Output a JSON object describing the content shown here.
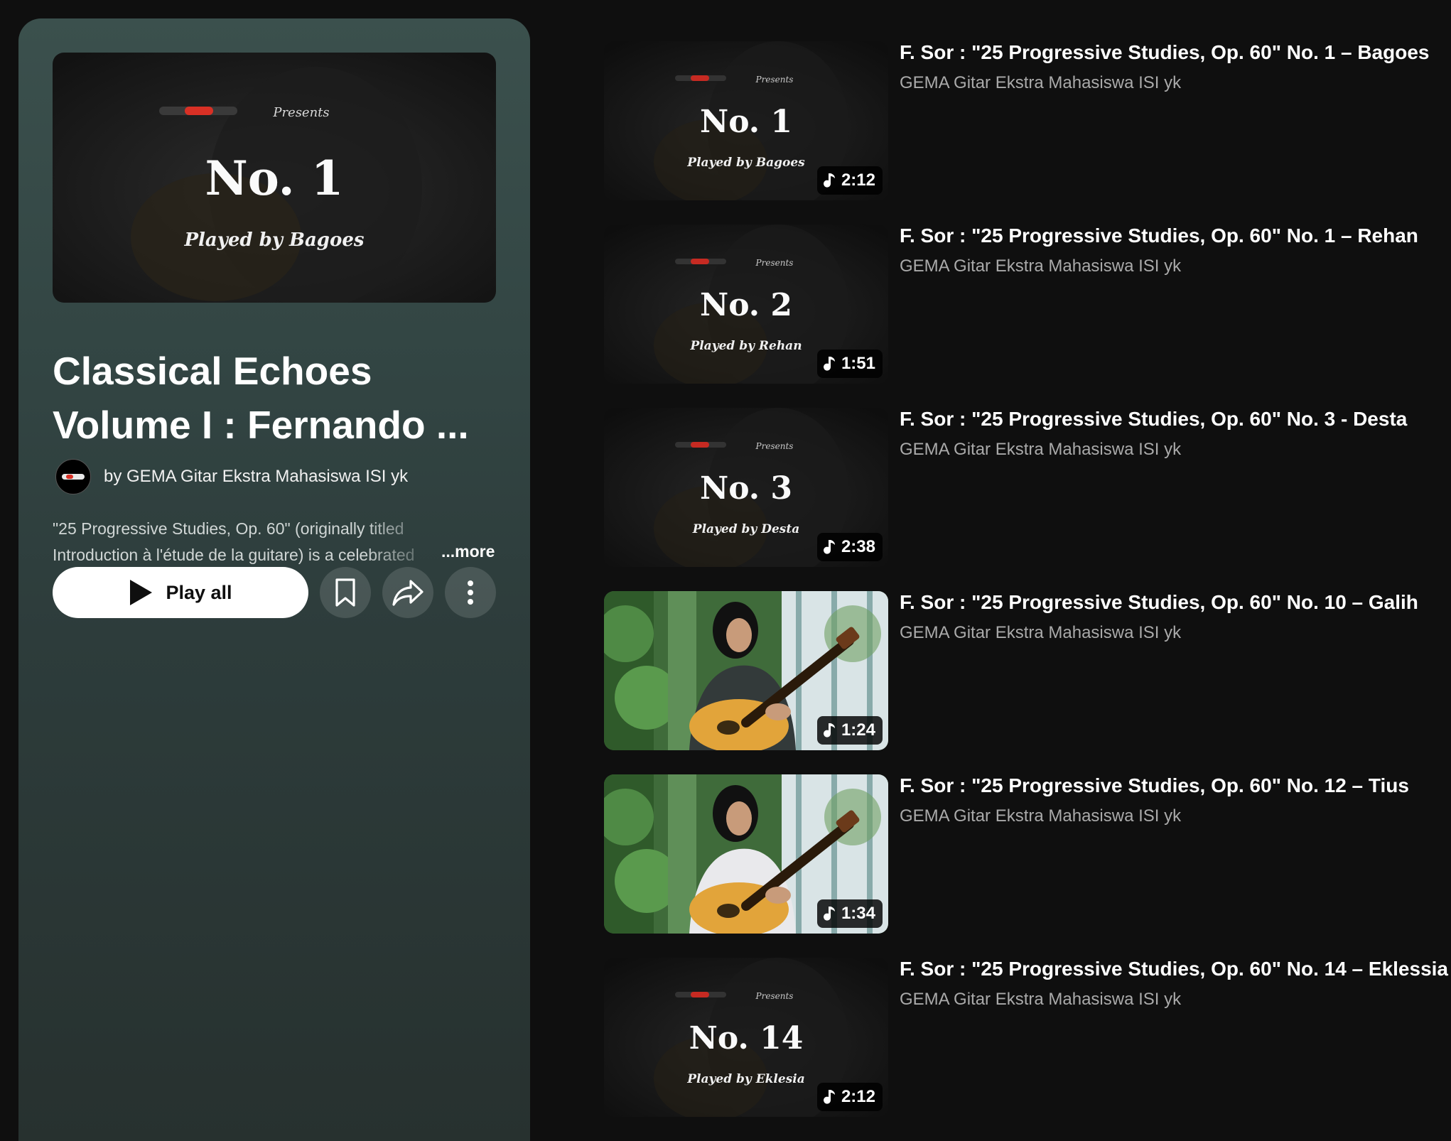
{
  "playlist": {
    "title_line1": "Classical Echoes",
    "title_line2": "Volume I : Fernando ...",
    "owner": "by GEMA Gitar Ekstra Mahasiswa ISI yk",
    "description_line1": "\"25 Progressive Studies, Op. 60\" (originally titled",
    "description_line2": "Introduction à l'étude de la guitare) is a celebrated",
    "more_label": "...more",
    "play_all_label": "Play all",
    "hero": {
      "presents": "Presents",
      "number": "No. 1",
      "played_by": "Played by Bagoes"
    }
  },
  "icons": {
    "play": "play-icon",
    "save": "bookmark-icon",
    "share": "share-icon",
    "menu": "more-vertical-icon",
    "music": "music-note-icon"
  },
  "videos": [
    {
      "title": "F. Sor : \"25 Progressive Studies, Op. 60\" No. 1 – Bagoes",
      "channel": "GEMA Gitar Ekstra Mahasiswa ISI yk",
      "duration": "2:12",
      "thumb": {
        "style": "card",
        "presents": "Presents",
        "number": "No. 1",
        "played_by": "Played by Bagoes"
      }
    },
    {
      "title": "F. Sor : \"25 Progressive Studies, Op. 60\" No. 1 – Rehan",
      "channel": "GEMA Gitar Ekstra Mahasiswa ISI yk",
      "duration": "1:51",
      "thumb": {
        "style": "card",
        "presents": "Presents",
        "number": "No. 2",
        "played_by": "Played by Rehan"
      }
    },
    {
      "title": "F. Sor : \"25 Progressive Studies, Op. 60\" No. 3 - Desta",
      "channel": "GEMA Gitar Ekstra Mahasiswa ISI yk",
      "duration": "2:38",
      "thumb": {
        "style": "card",
        "presents": "Presents",
        "number": "No. 3",
        "played_by": "Played by Desta"
      }
    },
    {
      "title": "F. Sor : \"25 Progressive Studies, Op. 60\" No. 10 – Galih",
      "channel": "GEMA Gitar Ekstra Mahasiswa ISI yk",
      "duration": "1:24",
      "thumb": {
        "style": "photo"
      }
    },
    {
      "title": "F. Sor : \"25 Progressive Studies, Op. 60\" No. 12 – Tius",
      "channel": "GEMA Gitar Ekstra Mahasiswa ISI yk",
      "duration": "1:34",
      "thumb": {
        "style": "photo"
      }
    },
    {
      "title": "F. Sor : \"25 Progressive Studies, Op. 60\" No. 14 – Eklessia",
      "channel": "GEMA Gitar Ekstra Mahasiswa ISI yk",
      "duration": "2:12",
      "thumb": {
        "style": "card",
        "presents": "Presents",
        "number": "No. 14",
        "played_by": "Played by Eklesia"
      }
    }
  ],
  "colors": {
    "page_bg": "#0f0f0f",
    "panel_top": "#3b504d",
    "panel_bottom": "#27312f",
    "accent_red": "#d93025"
  }
}
